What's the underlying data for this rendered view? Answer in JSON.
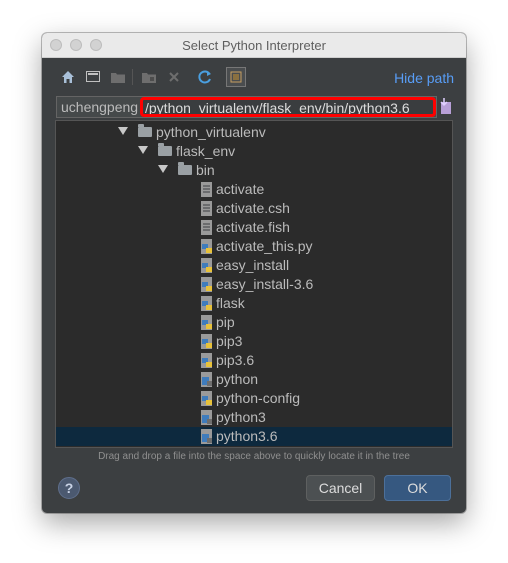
{
  "window": {
    "title": "Select Python Interpreter"
  },
  "toolbar": {
    "icons": [
      "home-icon",
      "desktop-icon",
      "project-folder-icon",
      "new-folder-icon",
      "delete-icon",
      "refresh-icon",
      "show-hidden-files-icon"
    ],
    "hide_path_label": "Hide path"
  },
  "path": {
    "prefix": "uchengpeng",
    "highlighted": "/python_virtualenv/flask_env/bin/python3.6",
    "highlight_color": "#ff0000"
  },
  "tree": {
    "folders": [
      "python_virtualenv",
      "flask_env",
      "bin"
    ],
    "files": [
      {
        "name": "activate",
        "icon": "text-file-icon"
      },
      {
        "name": "activate.csh",
        "icon": "text-file-icon"
      },
      {
        "name": "activate.fish",
        "icon": "text-file-icon"
      },
      {
        "name": "activate_this.py",
        "icon": "python-file-icon"
      },
      {
        "name": "easy_install",
        "icon": "python-file-icon"
      },
      {
        "name": "easy_install-3.6",
        "icon": "python-file-icon"
      },
      {
        "name": "flask",
        "icon": "python-file-icon"
      },
      {
        "name": "pip",
        "icon": "python-file-icon"
      },
      {
        "name": "pip3",
        "icon": "python-file-icon"
      },
      {
        "name": "pip3.6",
        "icon": "python-file-icon"
      },
      {
        "name": "python",
        "icon": "python-exec-icon"
      },
      {
        "name": "python-config",
        "icon": "python-file-icon"
      },
      {
        "name": "python3",
        "icon": "python-exec-icon"
      },
      {
        "name": "python3.6",
        "icon": "python-exec-icon"
      }
    ],
    "selected": "python3.6"
  },
  "hint": "Drag and drop a file into the space above to quickly locate it in the tree",
  "buttons": {
    "help": "?",
    "cancel": "Cancel",
    "ok": "OK"
  },
  "colors": {
    "accent": "#589df6",
    "ok_button": "#365880",
    "selection": "#0d293e"
  }
}
